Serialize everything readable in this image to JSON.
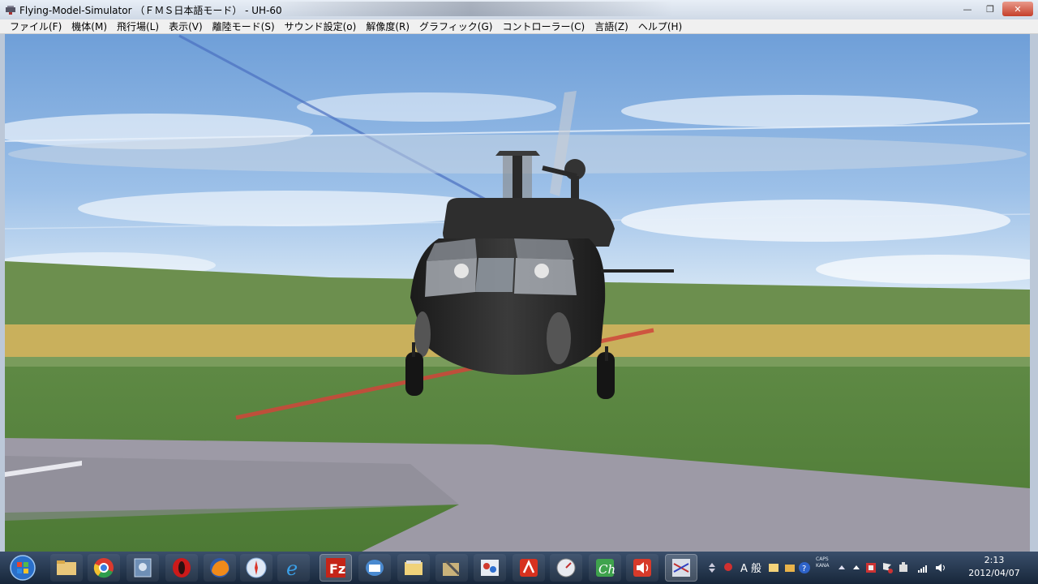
{
  "window": {
    "title": "Flying-Model-Simulator （ＦＭＳ日本語モード） - UH-60",
    "minimize": "—",
    "maximize": "❐",
    "close": "✕"
  },
  "menu": [
    {
      "label": "ファイル(F)"
    },
    {
      "label": "機体(M)"
    },
    {
      "label": "飛行場(L)"
    },
    {
      "label": "表示(V)"
    },
    {
      "label": "離陸モード(S)"
    },
    {
      "label": "サウンド設定(o)"
    },
    {
      "label": "解像度(R)"
    },
    {
      "label": "グラフィック(G)"
    },
    {
      "label": "コントローラー(C)"
    },
    {
      "label": "言語(Z)"
    },
    {
      "label": "ヘルプ(H)"
    }
  ],
  "taskbar": {
    "icons": [
      {
        "name": "explorer-icon"
      },
      {
        "name": "chrome-icon"
      },
      {
        "name": "app-icon"
      },
      {
        "name": "opera-icon"
      },
      {
        "name": "firefox-icon"
      },
      {
        "name": "safari-icon"
      },
      {
        "name": "ie-icon"
      },
      {
        "name": "filezilla-icon"
      },
      {
        "name": "mail-icon"
      },
      {
        "name": "folder-icon"
      },
      {
        "name": "tool-icon"
      },
      {
        "name": "network-icon"
      },
      {
        "name": "acrobat-icon"
      },
      {
        "name": "speedometer-icon"
      },
      {
        "name": "editor-icon"
      },
      {
        "name": "audio-icon"
      },
      {
        "name": "fms-icon"
      }
    ],
    "tray": {
      "ime_mode": "A 般",
      "caps": "CAPS",
      "kana": "KANA"
    },
    "clock": {
      "time": "2:13",
      "date": "2012/04/07"
    }
  }
}
